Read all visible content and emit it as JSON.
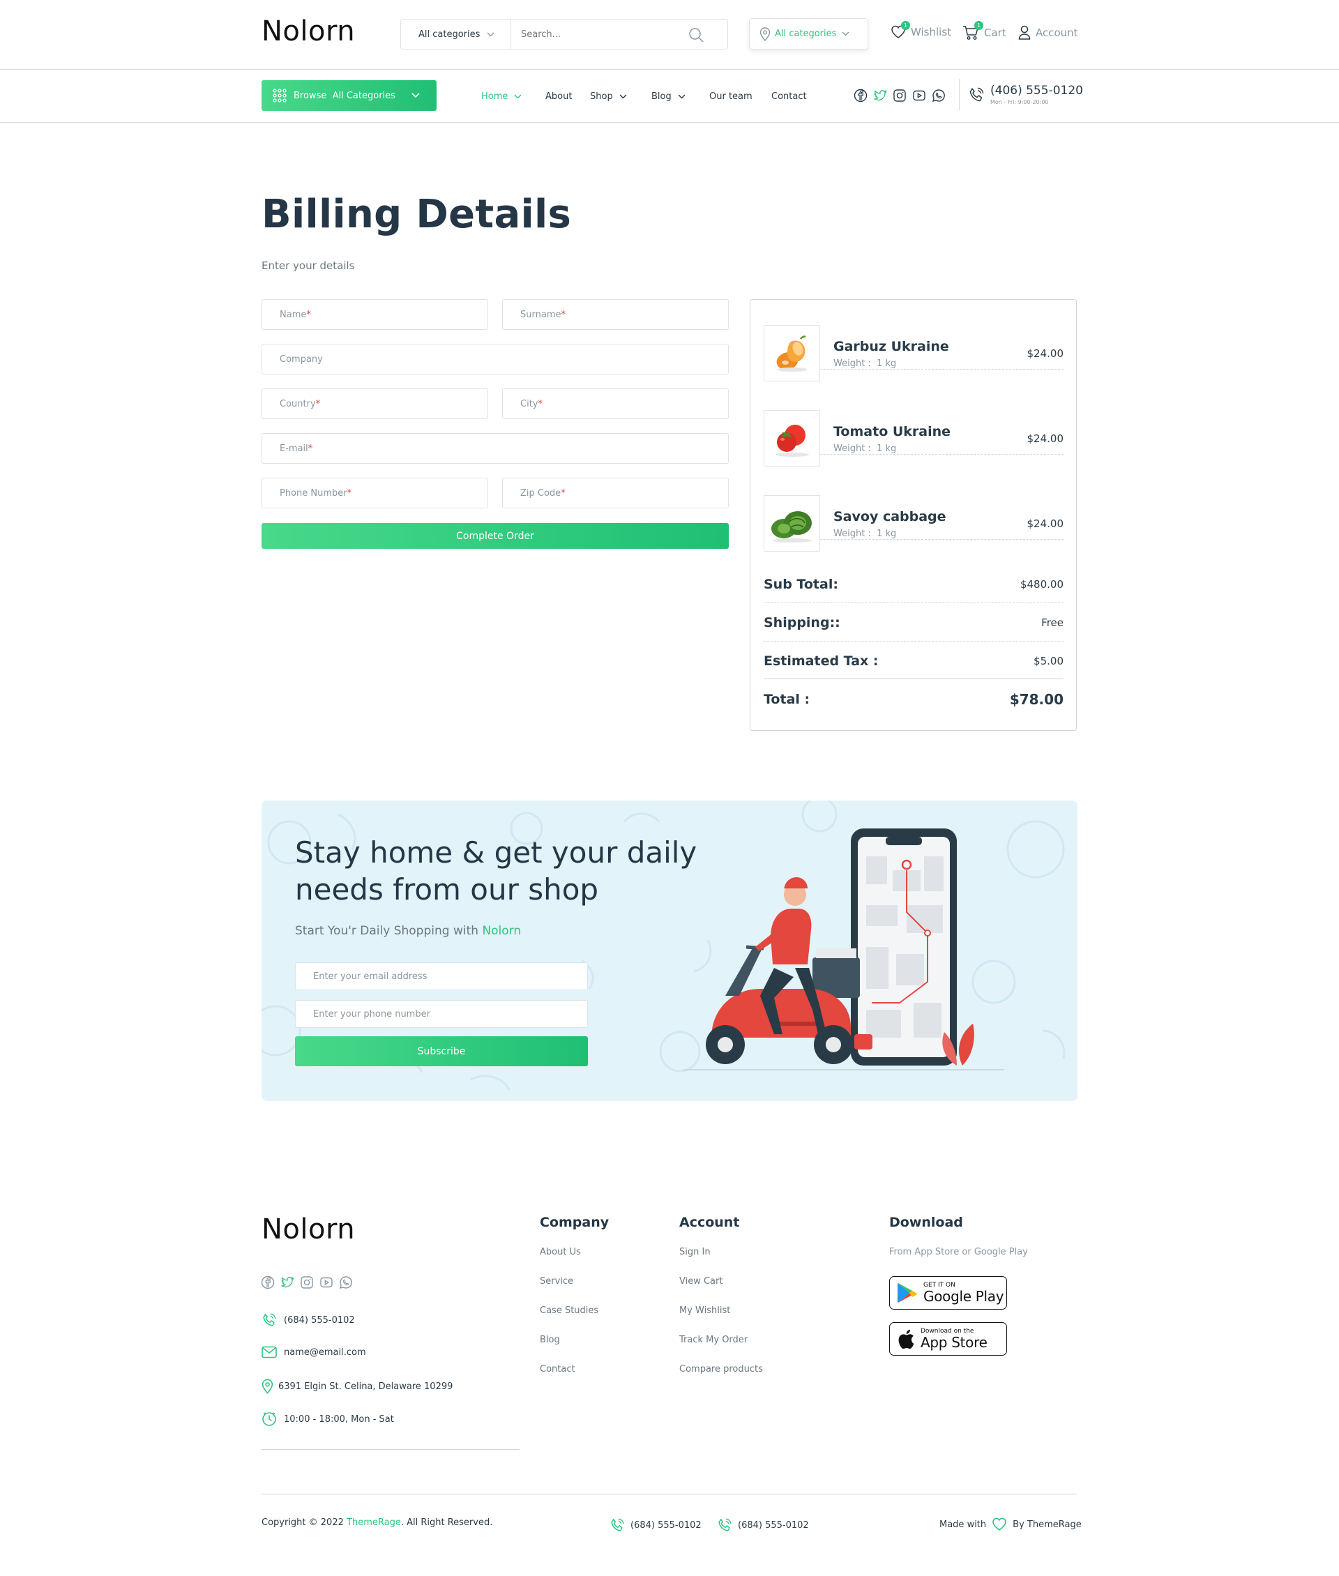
{
  "brand": "Nolorn",
  "colors": {
    "accent": "#2ec47f",
    "text": "#253746",
    "muted": "#8a97a1"
  },
  "header": {
    "search_category": "All categories",
    "search_placeholder": "Search...",
    "location_label": "All categories",
    "wishlist_label": "Wishlist",
    "wishlist_count": "1",
    "cart_label": "Cart",
    "cart_count": "1",
    "account_label": "Account"
  },
  "nav": {
    "browse_label": "Browse  All Categories",
    "items": [
      {
        "label": "Home",
        "dropdown": true,
        "active": true
      },
      {
        "label": "About",
        "dropdown": false
      },
      {
        "label": "Shop",
        "dropdown": true
      },
      {
        "label": "Blog",
        "dropdown": true
      },
      {
        "label": "Our team",
        "dropdown": false
      },
      {
        "label": "Contact",
        "dropdown": false
      }
    ],
    "social_icons": [
      "facebook-icon",
      "twitter-icon",
      "instagram-icon",
      "youtube-icon",
      "whatsapp-icon"
    ],
    "phone": "(406) 555-0120",
    "hours": "Mon - Fri: 9:00-20:00"
  },
  "billing": {
    "title": "Billing Details",
    "subtitle": "Enter your details",
    "fields": {
      "name": "Name",
      "surname": "Surname",
      "company": "Company",
      "country": "Country",
      "city": "City",
      "email": "E-mail",
      "phone": "Phone Number",
      "zip": "Zip Code"
    },
    "required_mark": "*",
    "submit_label": "Complete Order"
  },
  "summary": {
    "items": [
      {
        "name": "Garbuz Ukraine",
        "weight": "Weight :  1 kg",
        "price": "$24.00",
        "icon": "pumpkin-icon"
      },
      {
        "name": "Tomato Ukraine",
        "weight": "Weight :  1 kg",
        "price": "$24.00",
        "icon": "tomato-icon"
      },
      {
        "name": "Savoy cabbage",
        "weight": "Weight :  1 kg",
        "price": "$24.00",
        "icon": "cabbage-icon"
      }
    ],
    "subtotal_label": "Sub Total:",
    "subtotal_value": "$480.00",
    "shipping_label": "Shipping::",
    "shipping_value": "Free",
    "tax_label": "Estimated Tax :",
    "tax_value": "$5.00",
    "total_label": "Total :",
    "total_value": "$78.00"
  },
  "promo": {
    "title": "Stay home & get your daily needs from our shop",
    "subtitle": "Start You'r Daily Shopping with ",
    "subtitle_brand": "Nolorn",
    "email_placeholder": "Enter your email address",
    "phone_placeholder": "Enter your phone number",
    "subscribe_label": "Subscribe"
  },
  "footer": {
    "phone": "(684) 555-0102",
    "email": "name@email.com",
    "address": "6391 Elgin St. Celina, Delaware 10299",
    "hours": "10:00 - 18:00, Mon - Sat",
    "company_title": "Company",
    "company_links": [
      "About Us",
      "Service",
      "Case Studies",
      "Blog",
      "Contact"
    ],
    "account_title": "Account",
    "account_links": [
      "Sign In",
      "View Cart",
      "My Wishlist",
      "Track My Order",
      "Compare products"
    ],
    "download_title": "Download",
    "download_sub": "From App Store or Google Play",
    "google_small": "GET IT ON",
    "google_big": "Google Play",
    "apple_small": "Download on the",
    "apple_big": "App Store",
    "copyright_pre": "Copyright © 2022 ",
    "copyright_brand": "ThemeRage",
    "copyright_post": ". All Right Reserved.",
    "bottom_phone_1": "(684) 555-0102",
    "bottom_phone_2": "(684) 555-0102",
    "made_with": "Made with",
    "made_by": "By ThemeRage"
  }
}
